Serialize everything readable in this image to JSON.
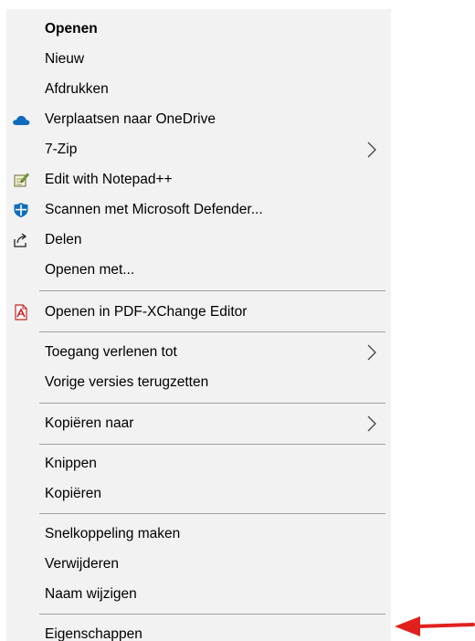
{
  "menu": {
    "items": [
      {
        "label": "Openen",
        "bold": true
      },
      {
        "label": "Nieuw"
      },
      {
        "label": "Afdrukken"
      },
      {
        "label": "Verplaatsen naar OneDrive",
        "icon": "onedrive-cloud-icon"
      },
      {
        "label": "7-Zip",
        "submenu": true
      },
      {
        "label": "Edit with Notepad++",
        "icon": "notepad-plus-plus-icon"
      },
      {
        "label": "Scannen met Microsoft Defender...",
        "icon": "microsoft-defender-icon"
      },
      {
        "label": "Delen",
        "icon": "share-icon"
      },
      {
        "label": "Openen met..."
      },
      {
        "label": "Openen in PDF-XChange Editor",
        "icon": "pdf-xchange-icon"
      },
      {
        "label": "Toegang verlenen tot",
        "submenu": true
      },
      {
        "label": "Vorige versies terugzetten"
      },
      {
        "label": "Kopiëren naar",
        "submenu": true
      },
      {
        "label": "Knippen"
      },
      {
        "label": "Kopiëren"
      },
      {
        "label": "Snelkoppeling maken"
      },
      {
        "label": "Verwijderen"
      },
      {
        "label": "Naam wijzigen"
      },
      {
        "label": "Eigenschappen"
      }
    ]
  },
  "colors": {
    "menu_background": "#f2f2f2",
    "separator": "#a0a0a0",
    "annotation_arrow": "#e0201c",
    "onedrive_blue": "#0f6cbd"
  }
}
